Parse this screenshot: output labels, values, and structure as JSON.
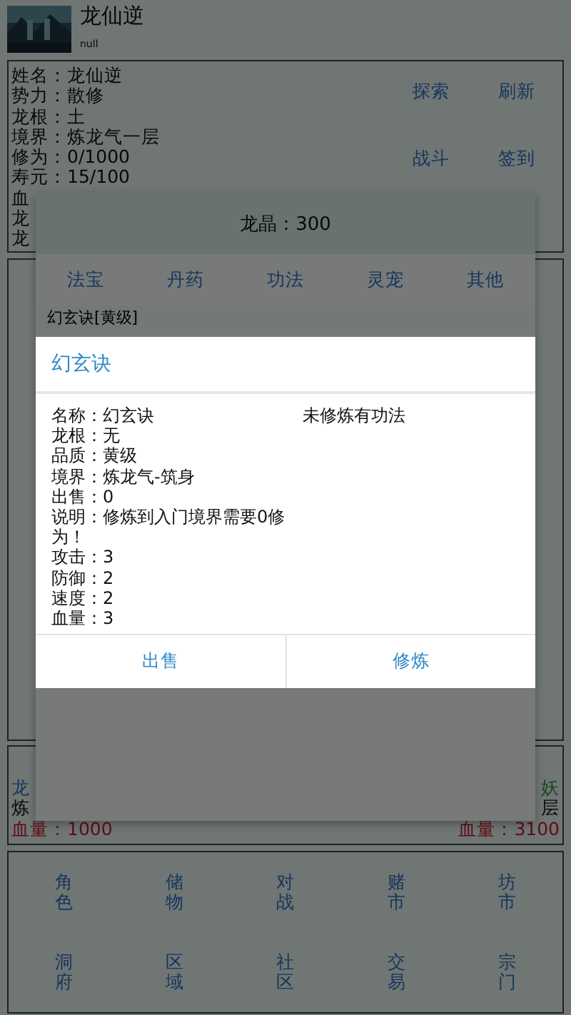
{
  "header": {
    "title": "龙仙逆",
    "subtitle": "null"
  },
  "profile": {
    "lines": [
      "姓名：龙仙逆",
      "势力：散修",
      "龙根：土",
      "境界：炼龙气一层",
      "修为：0/1000",
      "寿元：15/100",
      "血",
      "龙",
      "龙"
    ],
    "actions": [
      "探索",
      "刷新",
      "战斗",
      "签到"
    ]
  },
  "battle": {
    "left": {
      "name": "龙",
      "realm": "炼",
      "hp": "血量：1000"
    },
    "right": {
      "name": "妖",
      "realm": "层",
      "hp": "血量：3100"
    }
  },
  "nav": [
    "角色",
    "储物",
    "对战",
    "赌市",
    "坊市",
    "洞府",
    "区域",
    "社区",
    "交易",
    "宗门"
  ],
  "shop": {
    "balance": "龙晶：300",
    "tabs": [
      "法宝",
      "丹药",
      "功法",
      "灵宠",
      "其他"
    ],
    "items": [
      "幻玄诀[黄级]"
    ]
  },
  "dialog": {
    "title": "幻玄诀",
    "lines": [
      "名称：幻玄诀",
      "龙根：无",
      "品质：黄级",
      "境界：炼龙气-筑身",
      "出售：0",
      "说明：修炼到入门境界需要0修为！",
      "攻击：3",
      "防御：2",
      "速度：2",
      "血量：3"
    ],
    "status": "未修炼有功法",
    "buttons": [
      "出售",
      "修炼"
    ]
  }
}
